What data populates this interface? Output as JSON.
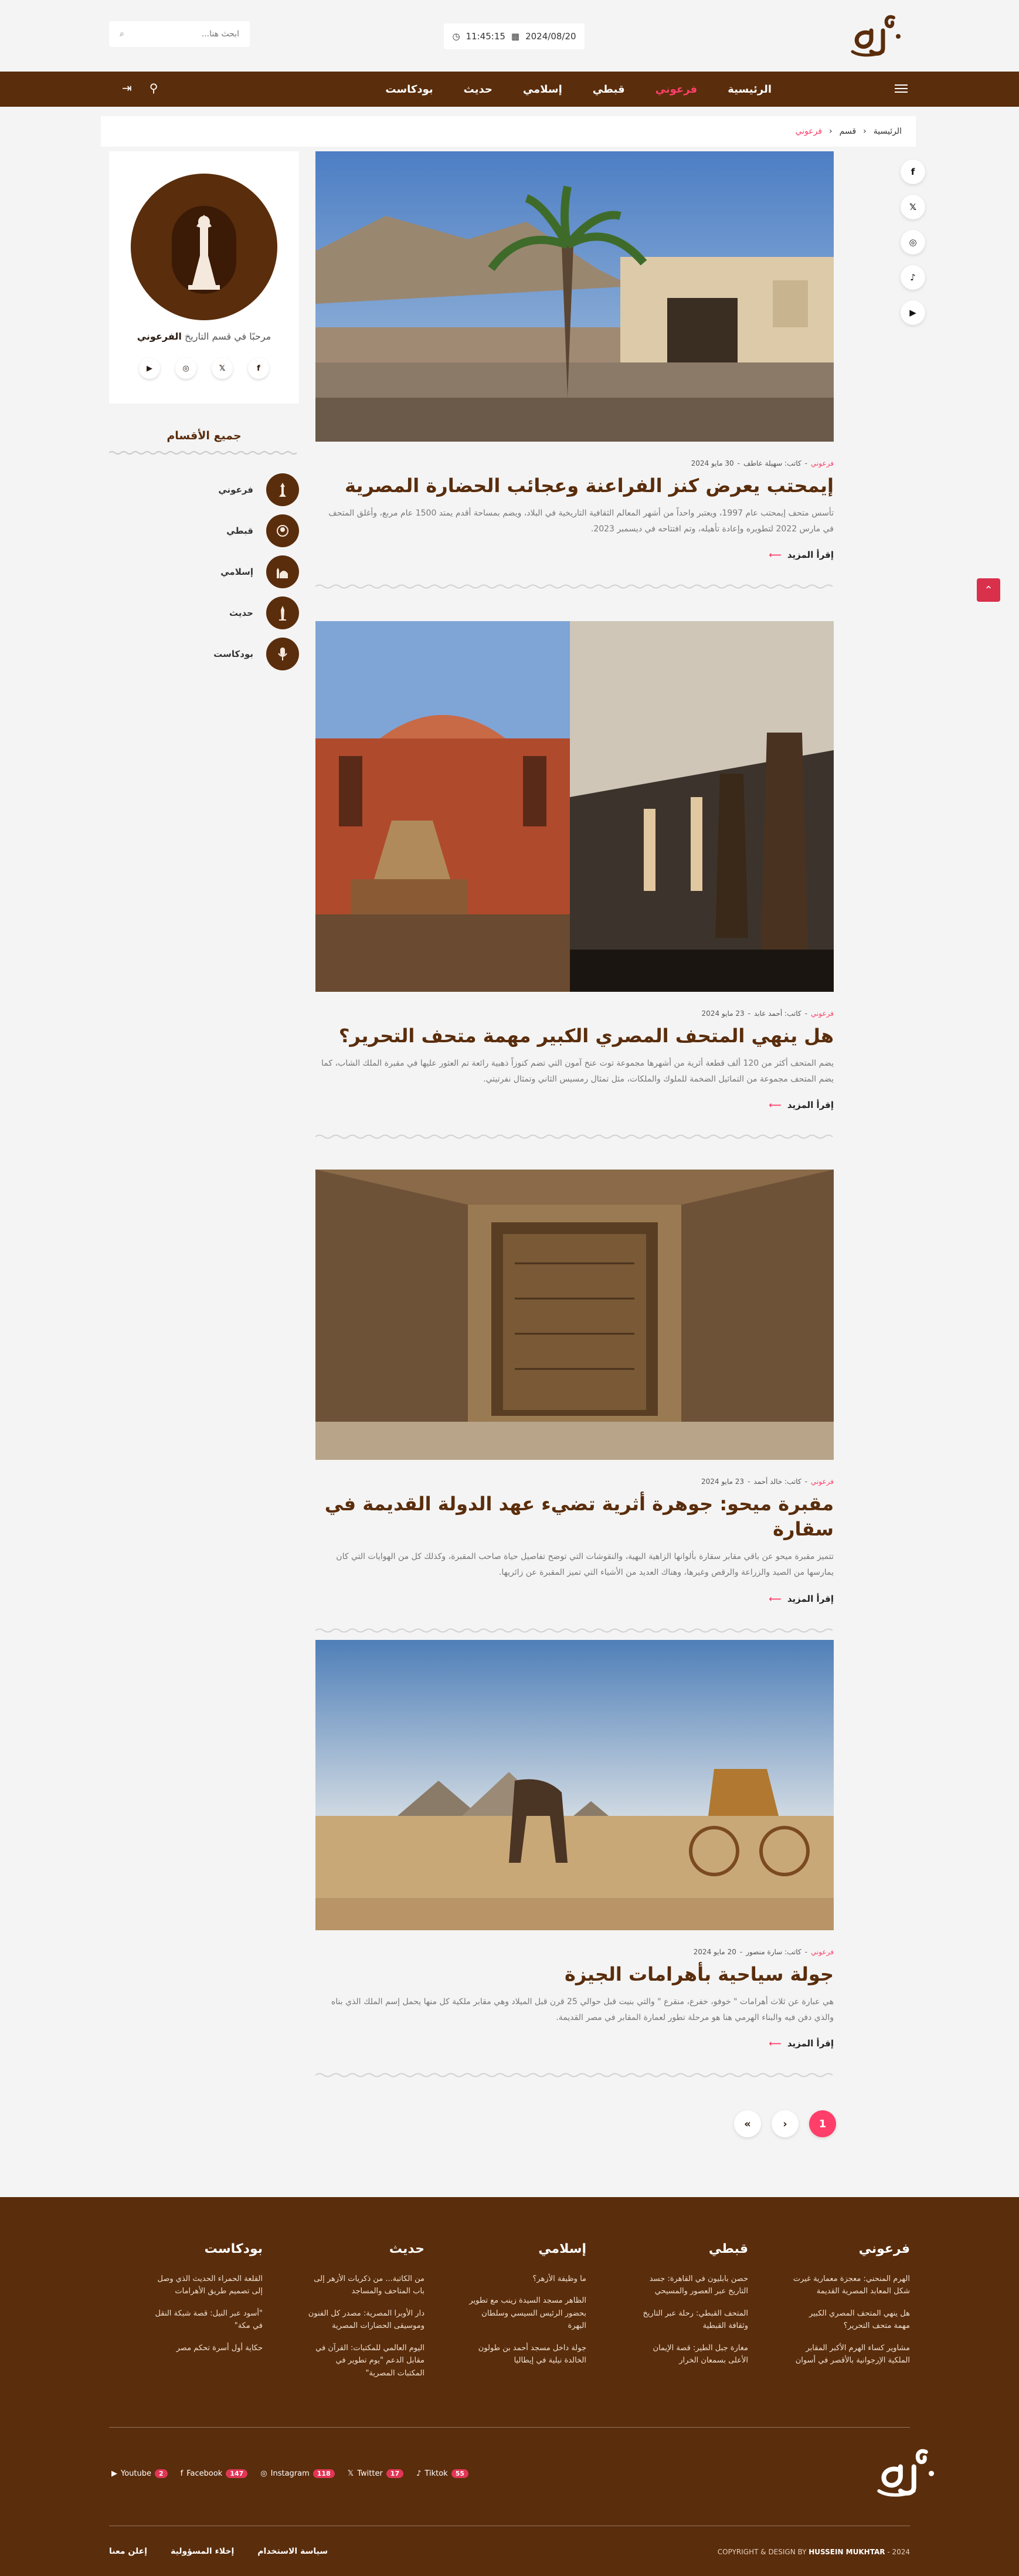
{
  "header": {
    "time": "11:45:15",
    "date": "2024/08/20",
    "search_placeholder": "ابحث هنا..."
  },
  "nav": {
    "items": [
      "الرئيسية",
      "فرعوني",
      "قبطي",
      "إسلامي",
      "حديث",
      "بودكاست"
    ],
    "active_index": 1
  },
  "breadcrumb": {
    "home": "الرئيسية",
    "section": "قسم",
    "current": "فرعوني"
  },
  "social_rail": [
    "f",
    "𝕏",
    "◎",
    "♪",
    "▶"
  ],
  "articles": [
    {
      "category": "فرعوني",
      "author": "كاتب: سهيلة عاطف",
      "date": "30 مايو 2024",
      "title": "إيمحتب يعرض كنز الفراعنة وعجائب الحضارة المصرية",
      "excerpt": "تأسس متحف إيمحتب عام 1997، ويعتبر واحداً من أشهر المعالم الثقافية التاريخية في البلاد، ويضم بمساحة أقدم يمتد 1500 عام مربع، وأغلق المتحف في مارس 2022 لتطويره وإعادة تأهيله، وتم افتتاحه في ديسمبر 2023.",
      "read_more": "إقرأ المزيد"
    },
    {
      "category": "فرعوني",
      "author": "كاتب: أحمد عابد",
      "date": "23 مايو 2024",
      "title": "هل ينهي المتحف المصري الكبير مهمة متحف التحرير؟",
      "excerpt": "يضم المتحف أكثر من 120 ألف قطعة أثرية من أشهرها مجموعة توت عنخ آمون التي تضم كنوزاً ذهبية رائعة تم العثور عليها في مقبرة الملك الشاب، كما يضم المتحف مجموعة من التماثيل الضخمة للملوك والملكات، مثل تمثال رمسيس الثاني وتمثال نفرتيتي.",
      "read_more": "إقرأ المزيد"
    },
    {
      "category": "فرعوني",
      "author": "كاتب: خالد أحمد",
      "date": "23 مايو 2024",
      "title": "مقبرة ميحو: جوهرة أثرية تضيء عهد الدولة القديمة في سقارة",
      "excerpt": "تتميز مقبرة ميحو عن باقي مقابر سقارة بألوانها الزاهية البهية، والنقوشات التي توضح تفاصيل حياة صاحب المقبرة، وكذلك كل من الهوايات التي كان يمارسها من الصيد والزراعة والرقص وغيرها، وهناك العديد من الأشياء التي تميز المقبرة عن زائريها.",
      "read_more": "إقرأ المزيد"
    },
    {
      "category": "فرعوني",
      "author": "كاتب: سارة منصور",
      "date": "20 مايو 2024",
      "title": "جولة سياحية بأهرامات الجيزة",
      "excerpt": "هي عبارة عن ثلاث أهرامات \" خوفو، خفرع، منقرع \" والتي بنيت قبل حوالي 25 قرن قبل الميلاد وهي مقابر ملكية كل منها يحمل إسم الملك الذي بناه والذي دفن فيه والبناء الهرمي هنا هو مرحلة تطور لعمارة المقابر في مصر القديمة.",
      "read_more": "إقرأ المزيد"
    }
  ],
  "sidebar": {
    "greeting_prefix": "مرحبًا في قسم التاريخ",
    "greeting_bold": "الفرعوني",
    "profile_social": [
      "f",
      "𝕏",
      "◎",
      "▶"
    ],
    "categories_title": "جميع الأقسام",
    "categories": [
      "فرعوني",
      "قبطي",
      "إسلامي",
      "حديث",
      "بودكاست"
    ]
  },
  "pagination": {
    "pages": [
      "«",
      "›",
      "1"
    ],
    "current": "1"
  },
  "footer": {
    "columns": [
      {
        "title": "فرعوني",
        "links": [
          "الهرم المنحني: معجزة معمارية غيرت شكل المعابد المصرية القديمة",
          "هل ينهي المتحف المصري الكبير مهمة متحف التحرير؟",
          "مشاوير كساء الهرم الأكبر المقابر الملكية الإرجوانية بالأقصر في أسوان"
        ]
      },
      {
        "title": "قبطي",
        "links": [
          "حصن بابليون في القاهرة: جسد التاريخ عبر العصور والمسيحي",
          "المتحف القبطي: رحلة عبر التاريخ وثقافة القبطية",
          "مغارة جبل الطير: قصة الإيمان الأعلى بسمعان الخرار"
        ]
      },
      {
        "title": "إسلامي",
        "links": [
          "ما وظيفة الأزهر؟",
          "الظاهر مسجد السيدة زينب مع تطوير بحضور الرئيس السيسي وسلطان البهرة",
          "جولة داخل مسجد أحمد بن طولون الخالدة نيلية في إيطاليا"
        ]
      },
      {
        "title": "حديث",
        "links": [
          "من الكاتبة... من ذكريات الأزهر إلى باب المتاحف والمساجد",
          "دار الأوبرا المصرية: مصدر كل الفنون وموسيقى الحضارات المصرية",
          "اليوم العالمي للمكتبات: القرآن في مقابل الدعم \"يوم تطوير في المكتبات المصرية\""
        ]
      },
      {
        "title": "بودكاست",
        "links": [
          "القلعة الحمراء الحديث الذي وصل إلى تصميم طريق الأهرامات",
          "\"أسود عبر النيل: قصة شبكة النقل في مكة\"",
          "حكاية أول أسرة تحكم مصر"
        ]
      }
    ],
    "social": [
      {
        "name": "Youtube",
        "count": "2"
      },
      {
        "name": "Facebook",
        "count": "147"
      },
      {
        "name": "Instagram",
        "count": "118"
      },
      {
        "name": "Twitter",
        "count": "17"
      },
      {
        "name": "Tiktok",
        "count": "55"
      }
    ],
    "bottom_links": [
      "سياسة الاستخدام",
      "إخلاء المسؤولية",
      "إعلن معنا"
    ],
    "copyright_prefix": "COPYRIGHT & DESIGN BY",
    "copyright_name": "HUSSEIN MUKHTAR",
    "copyright_year": "- 2024"
  }
}
